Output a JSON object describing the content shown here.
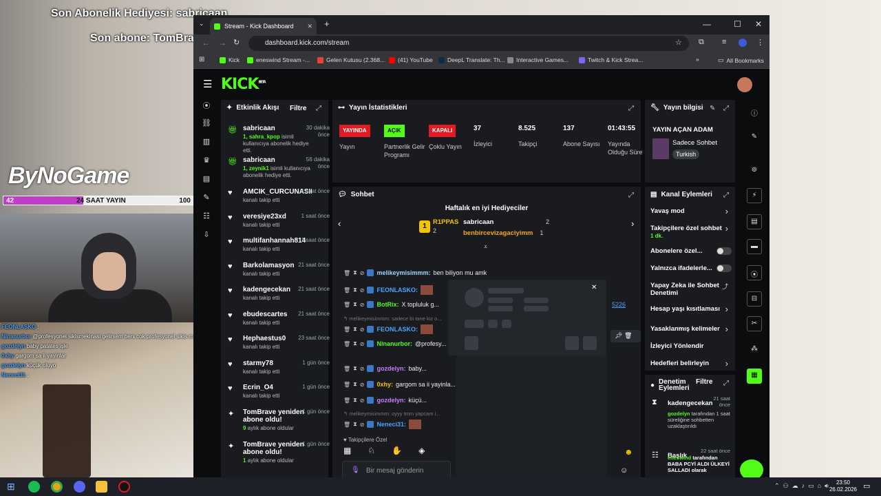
{
  "overlay": {
    "last_gift": "Son Abonelik Hediyesi: sabricaan",
    "last_sub": "Son abone: TomBrave",
    "logo": "ByNoGame",
    "bar_left": "42",
    "bar_mid": "24 SAAT YAYIN",
    "bar_right": "100",
    "bar_progress": 0.42,
    "chat": [
      {
        "user": "FEONLASKO",
        "text": ":"
      },
      {
        "user": "Ninanurbor",
        "text": "@profesyonel sikismekinasi gelirsem beni cok profesyonel sikis makinesiyle sikermisin??"
      },
      {
        "user": "gozdelyn",
        "text": "baby patates işle"
      },
      {
        "user": "0xhy",
        "text": "gargom sa ii yayinlar"
      },
      {
        "user": "gozdelyn",
        "text": "küçük oluyo"
      },
      {
        "user": "Neneci31",
        "text": ":"
      }
    ]
  },
  "browser": {
    "tab_title": "Stream - Kick Dashboard",
    "url": "dashboard.kick.com/stream",
    "bookmarks": [
      {
        "label": "Kick",
        "color": "#53fc18"
      },
      {
        "label": "eneswind Stream -...",
        "color": "#53fc18"
      },
      {
        "label": "Gelen Kutusu (2.368...",
        "color": "#ea4335"
      },
      {
        "label": "(41) YouTube",
        "color": "#ff0000"
      },
      {
        "label": "DeepL Translate: Th...",
        "color": "#0f2b46"
      },
      {
        "label": "Interactive Games...",
        "color": "#888888"
      },
      {
        "label": "Twitch & Kick Strea...",
        "color": "#7b68ee"
      }
    ],
    "all_bookmarks": "All Bookmarks"
  },
  "kick": {
    "logo": "KICK",
    "beta": "BETA",
    "activity": {
      "title": "Etkinlik Akışı",
      "filter": "Filtre",
      "events": [
        {
          "icon": "gift-icon",
          "name": "sabricaan",
          "time": "30 dakika önce",
          "sub_green": "1, sahra_kpop",
          "sub": "isimli kullanıcıya abonelik hediye etti."
        },
        {
          "icon": "gift-icon",
          "name": "sabricaan",
          "time": "56 dakika önce",
          "sub_green": "1, zeynik1",
          "sub": "isimli kullanıcıya abonelik hediye etti."
        },
        {
          "icon": "heart-icon",
          "name": "AMCIK_CURCUNASII",
          "time": "1 saat önce",
          "sub_green": "",
          "sub": "kanalı takip etti"
        },
        {
          "icon": "heart-icon",
          "name": "veresiye23xd",
          "time": "1 saat önce",
          "sub_green": "",
          "sub": "kanalı takip etti"
        },
        {
          "icon": "heart-icon",
          "name": "multifanhannah814",
          "time": "1 saat önce",
          "sub_green": "",
          "sub": "kanalı takip etti"
        },
        {
          "icon": "heart-icon",
          "name": "Barkolamasyon",
          "time": "21 saat önce",
          "sub_green": "",
          "sub": "kanalı takip etti"
        },
        {
          "icon": "heart-icon",
          "name": "kadengecekan",
          "time": "21 saat önce",
          "sub_green": "",
          "sub": "kanalı takip etti"
        },
        {
          "icon": "heart-icon",
          "name": "ebudescartes",
          "time": "21 saat önce",
          "sub_green": "",
          "sub": "kanalı takip etti"
        },
        {
          "icon": "heart-icon",
          "name": "Hephaestus0",
          "time": "23 saat önce",
          "sub_green": "",
          "sub": "kanalı takip etti"
        },
        {
          "icon": "heart-icon",
          "name": "starmy78",
          "time": "1 gün önce",
          "sub_green": "",
          "sub": "kanalı takip etti"
        },
        {
          "icon": "heart-icon",
          "name": "Ecrin_O4",
          "time": "1 gün önce",
          "sub_green": "",
          "sub": "kanalı takip etti"
        },
        {
          "icon": "star-icon",
          "name": "TomBrave yeniden abone oldu!",
          "time": "1 gün önce",
          "sub_green": "9",
          "sub": "aylık abone oldular"
        },
        {
          "icon": "star-icon",
          "name": "TomBrave yeniden abone oldu!",
          "time": "1 gün önce",
          "sub_green": "1",
          "sub": "aylık abone oldular"
        }
      ]
    },
    "stats": {
      "title": "Yayın İstatistikleri",
      "items": [
        {
          "badge": "YAYINDA",
          "badge_color": "#e01b24",
          "label": "Yayın"
        },
        {
          "badge": "AÇIK",
          "badge_color": "#53fc18",
          "label": "Partnerlik Gelir Programı"
        },
        {
          "badge": "KAPALI",
          "badge_color": "#e01b24",
          "label": "Çoklu Yayın"
        },
        {
          "value": "37",
          "label": "İzleyici"
        },
        {
          "value": "8.525",
          "label": "Takipçi"
        },
        {
          "value": "137",
          "label": "Abone Sayısı"
        },
        {
          "value": "01:43:55",
          "label": "Yayında Olduğu Süre"
        }
      ]
    },
    "info": {
      "title": "Yayın bilgisi",
      "stream_title": "YAYIN AÇAN ADAM",
      "category": "Sadece Sohbet",
      "tag": "Turkish"
    },
    "chat": {
      "title": "Sohbet",
      "gifters_title": "Haftalık en iyi Hediyeciler",
      "gifters": [
        {
          "rank": "1",
          "name": "R1PPAS",
          "count": "2"
        },
        {
          "rank": "",
          "name": "sabricaan",
          "count": "2"
        },
        {
          "rank": "",
          "name": "benbircevizagaciyimm",
          "count": "1"
        }
      ],
      "messages": [
        {
          "user": "melikeymisimmm",
          "color": "#9fd3ff",
          "text": "ben biliyon mu amk"
        },
        {
          "user": "FEONLASKO",
          "color": "#4aa3ff",
          "text": ""
        },
        {
          "user": "BotRix",
          "color": "#53fc18",
          "text": "X topluluk g..."
        },
        {
          "reply": "melikeymisimmm: sadece bi tane kiz o..."
        },
        {
          "user": "FEONLASKO",
          "color": "#4aa3ff",
          "text": ""
        },
        {
          "user": "Ninanurbor",
          "color": "#53fc18",
          "text": "@profesy... makinesiyle sikermisin??"
        },
        {
          "user": "gozdelyn",
          "color": "#c77dff",
          "text": "baby..."
        },
        {
          "user": "0xhy",
          "color": "#f5c400",
          "text": "gargom sa ii yayinla..."
        },
        {
          "user": "gozdelyn",
          "color": "#c77dff",
          "text": "küçü..."
        },
        {
          "reply": "melikeymisimmm: oyyy tmm yapcam i..."
        },
        {
          "user": "Neneci31",
          "color": "#4aa3ff",
          "text": ""
        }
      ],
      "followers_only": "Takipçilere Özel",
      "placeholder": "Bir mesaj gönderin",
      "link_snippet": "5226",
      "counter1": "0",
      "counter2": "0",
      "send_label": "nder"
    },
    "actions": {
      "title": "Kanal Eylemleri",
      "items": [
        {
          "label": "Yavaş mod",
          "kind": "chevron",
          "sub": ""
        },
        {
          "label": "Takipçilere özel sohbet",
          "kind": "chevron",
          "sub": "1 dk."
        },
        {
          "label": "Abonelere özel...",
          "kind": "toggle",
          "sub": ""
        },
        {
          "label": "Yalnızca ifadelerle...",
          "kind": "toggle",
          "sub": ""
        },
        {
          "label": "Yapay Zeka ile Sohbet Denetimi",
          "kind": "ext",
          "sub": ""
        },
        {
          "label": "Hesap yaşı kısıtlaması",
          "kind": "chevron",
          "sub": ""
        },
        {
          "label": "Yasaklanmış kelimeler",
          "kind": "chevron",
          "sub": ""
        },
        {
          "label": "İzleyici Yönlendir",
          "kind": "none",
          "sub": ""
        },
        {
          "label": "Hedefleri belirleyin",
          "kind": "chevron",
          "sub": ""
        }
      ]
    },
    "moderation": {
      "title": "Denetim Eylemleri",
      "filter": "Filtre",
      "items": [
        {
          "name": "kadengecekan",
          "time": "21 saat önce",
          "actor": "gozdelyn",
          "text": "tarafından 1 saat süreliğine sohbetten uzaklaştırıldı"
        },
        {
          "name": "Başlık",
          "time": "22 saat önce",
          "actor": "eneswind",
          "text": "tarafından BABA PCYİ ALDI ÜLKEYİ SALLADI olarak"
        }
      ]
    }
  },
  "taskbar": {
    "time": "23:50",
    "date": "26.02.2026"
  }
}
